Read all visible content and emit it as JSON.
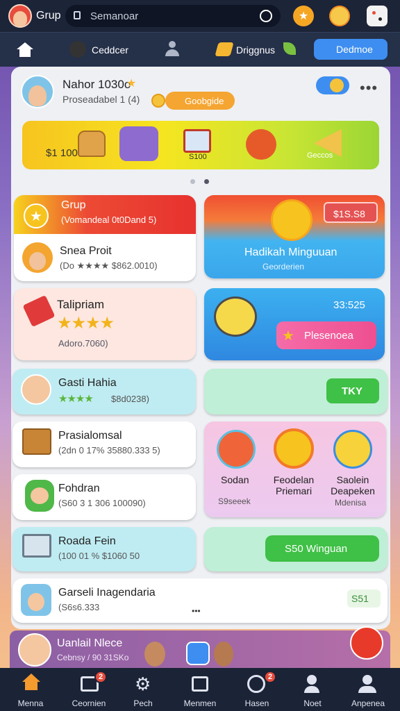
{
  "topbar": {
    "group_label": "Grup",
    "search_placeholder": "Semanoar"
  },
  "navbar": {
    "item1": "Ceddcer",
    "item2": "Driggnus",
    "item3": "Dedmoe"
  },
  "profile": {
    "name": "Nahor 1030o",
    "subtitle": "Proseadabel 1 (4)",
    "coin_pill": "Goobgide",
    "coin_value": "$1 100",
    "banner_item_mid": "S100",
    "banner_item_last": "Geccos"
  },
  "cards": {
    "grup": {
      "title": "Grup",
      "subtitle": "(Vomandeal 0t0Dand 5)"
    },
    "hadiah": {
      "title": "Hadikah Minguuan",
      "subtitle": "Georderien",
      "price": "$1S.S8"
    },
    "snea": {
      "title": "Snea Proit",
      "subtitle": "(Do ★★★★ $862.0010)"
    },
    "talip": {
      "title": "Talipriam",
      "subtitle": "Adoro.7060)"
    },
    "bonus": {
      "value": "33:525",
      "button": "Plesenoea"
    },
    "gasti": {
      "title": "Gasti Hahia",
      "subtitle": "$8d0238)"
    },
    "tky": {
      "button": "TKY"
    },
    "prasial": {
      "title": "Prasialomsal",
      "subtitle": "(2dn 0 17% 35880.333 5)"
    },
    "trio": {
      "items": [
        {
          "title": "Sodan",
          "sub": "S9seeek"
        },
        {
          "title": "Feodelan Priemari",
          "sub": ""
        },
        {
          "title": "Saolein Deapeken",
          "sub": "Mdenisa"
        }
      ]
    },
    "fohdran": {
      "title": "Fohdran",
      "subtitle": "(S60 3 1 306 100090)"
    },
    "roada": {
      "title": "Roada Fein",
      "subtitle": "(100 01 % $1060 50"
    },
    "winguan": {
      "button": "S50 Winguan"
    },
    "garseli": {
      "title": "Garseli Inagendaria",
      "subtitle": "(S6s6.333",
      "badge": "S51"
    }
  },
  "footer_profile": {
    "name": "Uanlail Nlece",
    "subtitle": "Cebnsy / 90 31SKo"
  },
  "bottom_nav": [
    {
      "label": "Menna",
      "icon": "home-icon"
    },
    {
      "label": "Ceornien",
      "icon": "store-icon",
      "badge": "2"
    },
    {
      "label": "Pech",
      "icon": "gear-icon"
    },
    {
      "label": "Menmen",
      "icon": "book-icon"
    },
    {
      "label": "Hasen",
      "icon": "compass-icon",
      "badge": "2"
    },
    {
      "label": "Noet",
      "icon": "person-icon"
    },
    {
      "label": "Anpenea",
      "icon": "user-icon"
    }
  ]
}
